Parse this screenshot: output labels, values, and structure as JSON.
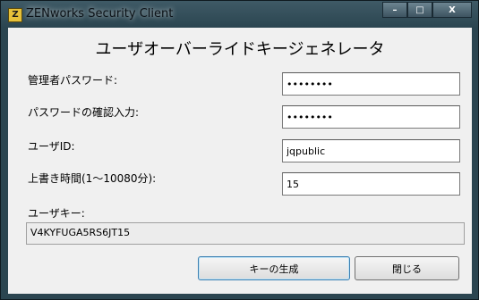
{
  "window": {
    "title": "ZENworks Security Client",
    "icon_text": "Z"
  },
  "controls": {
    "minimize": "–",
    "maximize": "□",
    "close": "X"
  },
  "dialog": {
    "heading": "ユーザオーバーライドキージェネレータ",
    "admin_password_label": "管理者パスワード:",
    "admin_password_value": "••••••••",
    "confirm_password_label": "パスワードの確認入力:",
    "confirm_password_value": "••••••••",
    "user_id_label": "ユーザID:",
    "user_id_value": "jqpublic",
    "override_time_label": "上書き時間(1〜10080分):",
    "override_time_value": "15",
    "user_key_label": "ユーザキー:",
    "user_key_value": "V4KYFUGA5RS6JT15",
    "generate_button": "キーの生成",
    "close_button": "閉じる"
  }
}
